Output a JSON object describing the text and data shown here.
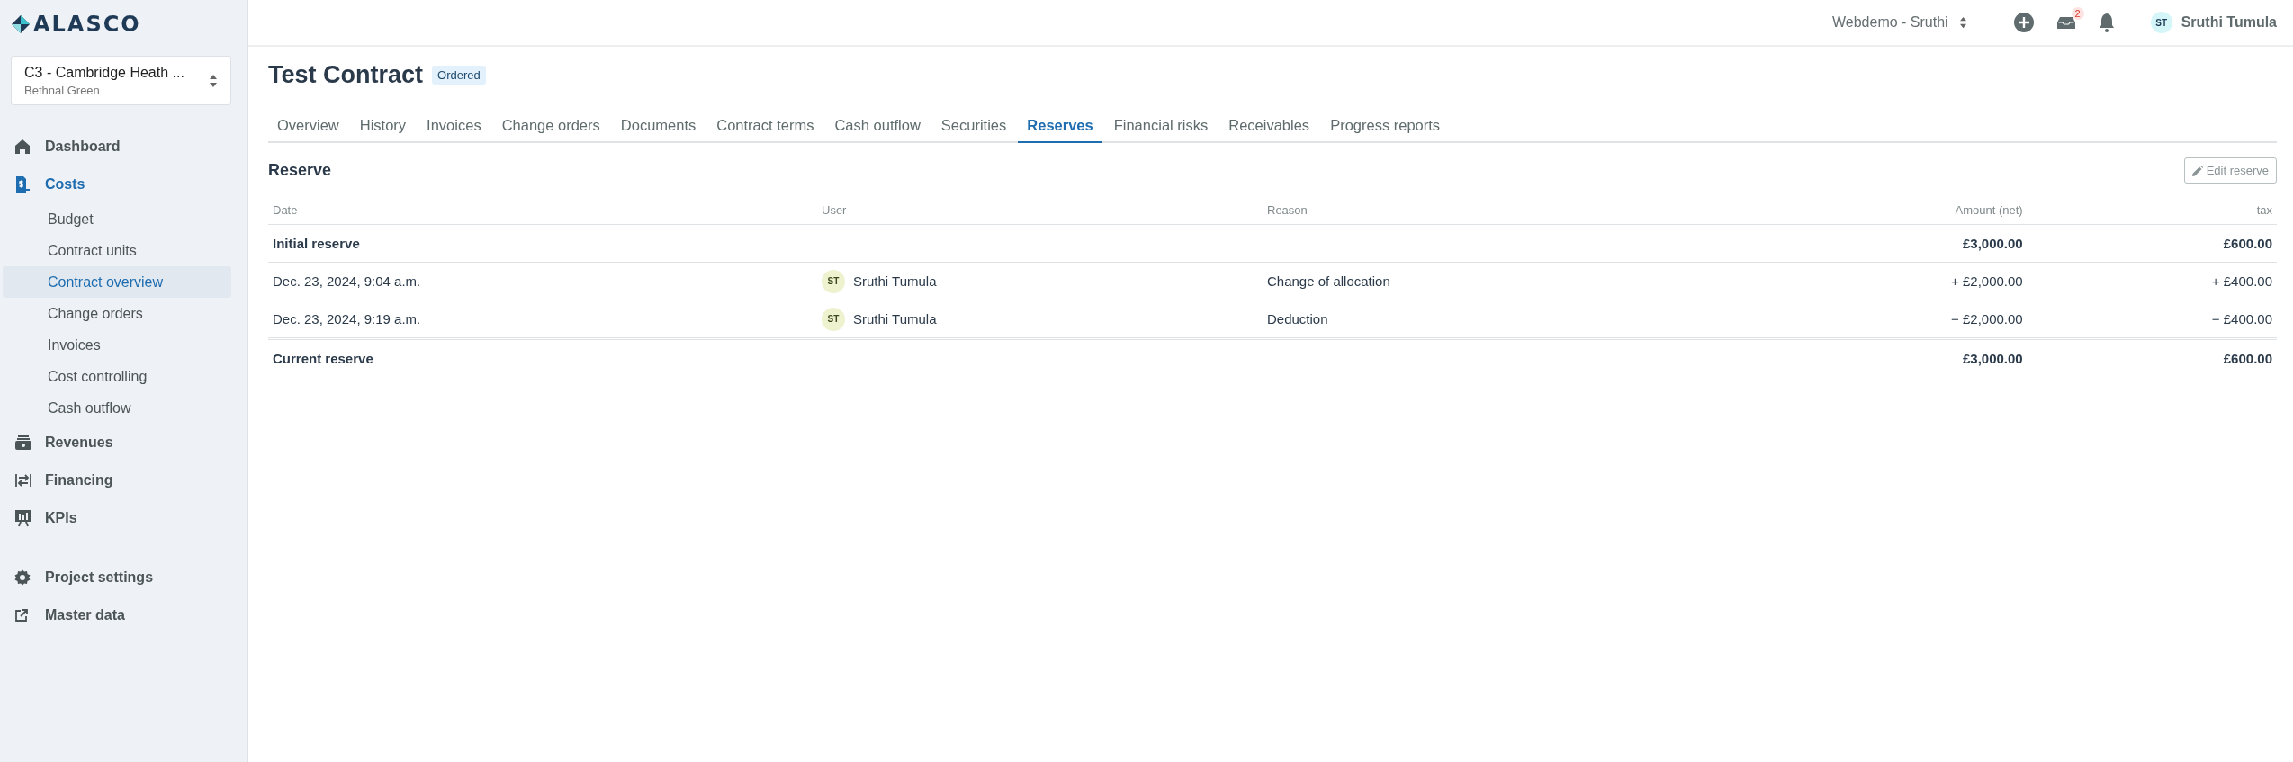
{
  "logo": {
    "text": "ALASCO"
  },
  "project": {
    "name": "C3 - Cambridge Heath ...",
    "location": "Bethnal Green"
  },
  "nav": [
    {
      "label": "Dashboard",
      "selected": false
    },
    {
      "label": "Costs",
      "selected": true,
      "children": [
        {
          "label": "Budget",
          "selected": false
        },
        {
          "label": "Contract units",
          "selected": false
        },
        {
          "label": "Contract overview",
          "selected": true
        },
        {
          "label": "Change orders",
          "selected": false
        },
        {
          "label": "Invoices",
          "selected": false
        },
        {
          "label": "Cost controlling",
          "selected": false
        },
        {
          "label": "Cash outflow",
          "selected": false
        }
      ]
    },
    {
      "label": "Revenues",
      "selected": false
    },
    {
      "label": "Financing",
      "selected": false
    },
    {
      "label": "KPIs",
      "selected": false
    }
  ],
  "footer_nav": [
    {
      "label": "Project settings"
    },
    {
      "label": "Master data"
    }
  ],
  "topbar": {
    "workspace": "Webdemo - Sruthi",
    "inbox_count": "2",
    "user_initials": "ST",
    "user_name": "Sruthi Tumula"
  },
  "page": {
    "title": "Test Contract",
    "status": "Ordered"
  },
  "tabs": [
    {
      "label": "Overview",
      "selected": false
    },
    {
      "label": "History",
      "selected": false
    },
    {
      "label": "Invoices",
      "selected": false
    },
    {
      "label": "Change orders",
      "selected": false
    },
    {
      "label": "Documents",
      "selected": false
    },
    {
      "label": "Contract terms",
      "selected": false
    },
    {
      "label": "Cash outflow",
      "selected": false
    },
    {
      "label": "Securities",
      "selected": false
    },
    {
      "label": "Reserves",
      "selected": true
    },
    {
      "label": "Financial risks",
      "selected": false
    },
    {
      "label": "Receivables",
      "selected": false
    },
    {
      "label": "Progress reports",
      "selected": false
    }
  ],
  "section": {
    "title": "Reserve",
    "edit_button": "Edit reserve"
  },
  "table": {
    "columns": [
      "Date",
      "User",
      "Reason",
      "Amount (net)",
      "tax"
    ],
    "rows": [
      {
        "kind": "total",
        "date": "Initial reserve",
        "amount": "£3,000.00",
        "tax": "£600.00"
      },
      {
        "kind": "entry",
        "date": "Dec. 23, 2024, 9:04 a.m.",
        "user_initials": "ST",
        "user": "Sruthi Tumula",
        "reason": "Change of allocation",
        "amount": "+ £2,000.00",
        "tax": "+ £400.00"
      },
      {
        "kind": "entry",
        "date": "Dec. 23, 2024, 9:19 a.m.",
        "user_initials": "ST",
        "user": "Sruthi Tumula",
        "reason": "Deduction",
        "amount": "− £2,000.00",
        "tax": "− £400.00"
      },
      {
        "kind": "total",
        "date": "Current reserve",
        "amount": "£3,000.00",
        "tax": "£600.00"
      }
    ]
  }
}
